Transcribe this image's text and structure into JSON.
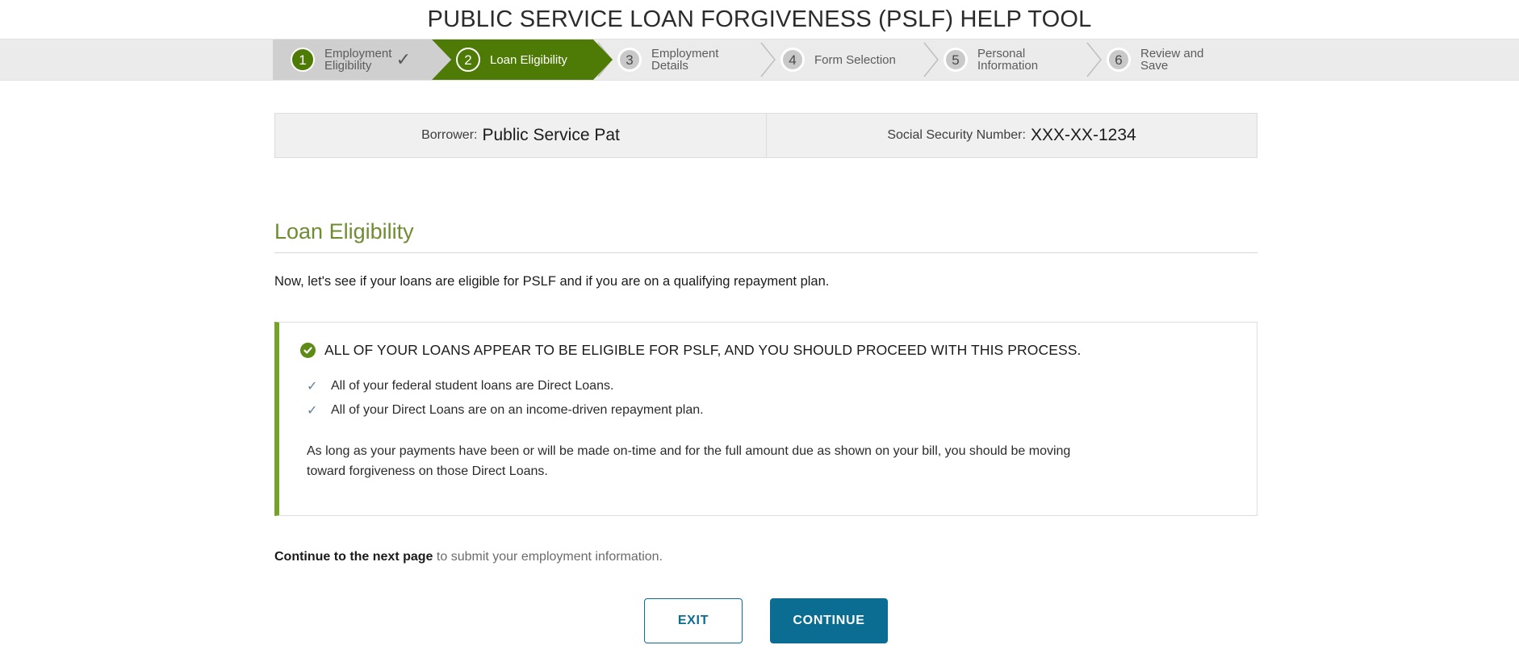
{
  "header": {
    "title": "PUBLIC SERVICE LOAN FORGIVENESS (PSLF) HELP TOOL"
  },
  "stepper": {
    "completed_check": "✓",
    "steps": [
      {
        "number": "1",
        "label": "Employment Eligibility",
        "state": "completed"
      },
      {
        "number": "2",
        "label": "Loan Eligibility",
        "state": "current"
      },
      {
        "number": "3",
        "label": "Employment Details",
        "state": "upcoming"
      },
      {
        "number": "4",
        "label": "Form Selection",
        "state": "upcoming"
      },
      {
        "number": "5",
        "label": "Personal Information",
        "state": "upcoming"
      },
      {
        "number": "6",
        "label": "Review and Save",
        "state": "upcoming"
      }
    ]
  },
  "borrower_bar": {
    "borrower_label": "Borrower:",
    "borrower_value": "Public Service Pat",
    "ssn_label": "Social Security Number:",
    "ssn_value": "XXX-XX-1234"
  },
  "main": {
    "section_title": "Loan Eligibility",
    "intro": "Now, let's see if your loans are eligible for PSLF and if you are on a qualifying repayment plan.",
    "callout": {
      "title": "ALL OF YOUR LOANS APPEAR TO BE ELIGIBLE FOR PSLF, AND YOU SHOULD PROCEED WITH THIS PROCESS.",
      "check_glyph": "✓",
      "items": [
        "All of your federal student loans are Direct Loans.",
        "All of your Direct Loans are on an income-driven repayment plan."
      ],
      "note": "As long as your payments have been or will be made on-time and for the full amount due as shown on your bill, you should be moving toward forgiveness on those Direct Loans."
    },
    "footer_strong": "Continue to the next page",
    "footer_rest": " to submit your employment information."
  },
  "buttons": {
    "exit": "EXIT",
    "continue": "CONTINUE"
  },
  "colors": {
    "brand_green": "#4e7b06",
    "heading_green": "#6f8c33",
    "callout_green": "#77a12b",
    "button_blue": "#0b6d91",
    "stepper_bg": "#ebebeb",
    "completed_band": "#cfcfcf"
  }
}
